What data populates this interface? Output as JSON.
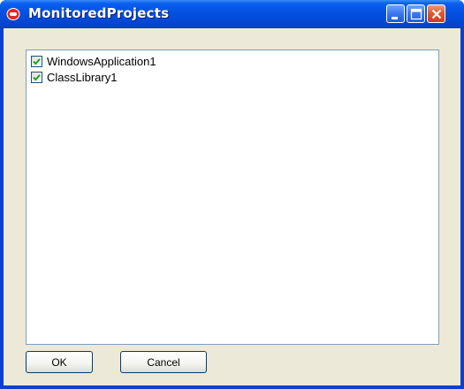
{
  "window": {
    "title": "MonitoredProjects",
    "app_icon": "app-icon",
    "buttons": [
      "minimize-icon",
      "maximize-icon",
      "close-icon"
    ]
  },
  "list": {
    "items": [
      {
        "label": "WindowsApplication1",
        "checked": true
      },
      {
        "label": "ClassLibrary1",
        "checked": true
      }
    ]
  },
  "footer": {
    "ok_label": "OK",
    "cancel_label": "Cancel"
  },
  "colors": {
    "titlebar": "#0450e0",
    "dialog_background": "#ece9d8",
    "check_mark": "#21a121",
    "list_border": "#7f9db9"
  }
}
